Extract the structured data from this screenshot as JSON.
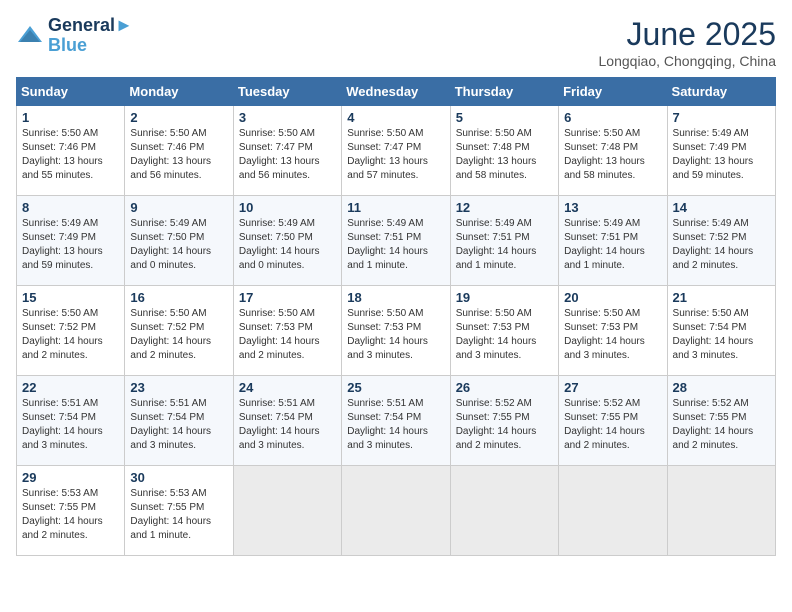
{
  "header": {
    "logo_line1": "General",
    "logo_line2": "Blue",
    "month_title": "June 2025",
    "location": "Longqiao, Chongqing, China"
  },
  "columns": [
    "Sunday",
    "Monday",
    "Tuesday",
    "Wednesday",
    "Thursday",
    "Friday",
    "Saturday"
  ],
  "weeks": [
    [
      {
        "day": "1",
        "info": "Sunrise: 5:50 AM\nSunset: 7:46 PM\nDaylight: 13 hours\nand 55 minutes."
      },
      {
        "day": "2",
        "info": "Sunrise: 5:50 AM\nSunset: 7:46 PM\nDaylight: 13 hours\nand 56 minutes."
      },
      {
        "day": "3",
        "info": "Sunrise: 5:50 AM\nSunset: 7:47 PM\nDaylight: 13 hours\nand 56 minutes."
      },
      {
        "day": "4",
        "info": "Sunrise: 5:50 AM\nSunset: 7:47 PM\nDaylight: 13 hours\nand 57 minutes."
      },
      {
        "day": "5",
        "info": "Sunrise: 5:50 AM\nSunset: 7:48 PM\nDaylight: 13 hours\nand 58 minutes."
      },
      {
        "day": "6",
        "info": "Sunrise: 5:50 AM\nSunset: 7:48 PM\nDaylight: 13 hours\nand 58 minutes."
      },
      {
        "day": "7",
        "info": "Sunrise: 5:49 AM\nSunset: 7:49 PM\nDaylight: 13 hours\nand 59 minutes."
      }
    ],
    [
      {
        "day": "8",
        "info": "Sunrise: 5:49 AM\nSunset: 7:49 PM\nDaylight: 13 hours\nand 59 minutes."
      },
      {
        "day": "9",
        "info": "Sunrise: 5:49 AM\nSunset: 7:50 PM\nDaylight: 14 hours\nand 0 minutes."
      },
      {
        "day": "10",
        "info": "Sunrise: 5:49 AM\nSunset: 7:50 PM\nDaylight: 14 hours\nand 0 minutes."
      },
      {
        "day": "11",
        "info": "Sunrise: 5:49 AM\nSunset: 7:51 PM\nDaylight: 14 hours\nand 1 minute."
      },
      {
        "day": "12",
        "info": "Sunrise: 5:49 AM\nSunset: 7:51 PM\nDaylight: 14 hours\nand 1 minute."
      },
      {
        "day": "13",
        "info": "Sunrise: 5:49 AM\nSunset: 7:51 PM\nDaylight: 14 hours\nand 1 minute."
      },
      {
        "day": "14",
        "info": "Sunrise: 5:49 AM\nSunset: 7:52 PM\nDaylight: 14 hours\nand 2 minutes."
      }
    ],
    [
      {
        "day": "15",
        "info": "Sunrise: 5:50 AM\nSunset: 7:52 PM\nDaylight: 14 hours\nand 2 minutes."
      },
      {
        "day": "16",
        "info": "Sunrise: 5:50 AM\nSunset: 7:52 PM\nDaylight: 14 hours\nand 2 minutes."
      },
      {
        "day": "17",
        "info": "Sunrise: 5:50 AM\nSunset: 7:53 PM\nDaylight: 14 hours\nand 2 minutes."
      },
      {
        "day": "18",
        "info": "Sunrise: 5:50 AM\nSunset: 7:53 PM\nDaylight: 14 hours\nand 3 minutes."
      },
      {
        "day": "19",
        "info": "Sunrise: 5:50 AM\nSunset: 7:53 PM\nDaylight: 14 hours\nand 3 minutes."
      },
      {
        "day": "20",
        "info": "Sunrise: 5:50 AM\nSunset: 7:53 PM\nDaylight: 14 hours\nand 3 minutes."
      },
      {
        "day": "21",
        "info": "Sunrise: 5:50 AM\nSunset: 7:54 PM\nDaylight: 14 hours\nand 3 minutes."
      }
    ],
    [
      {
        "day": "22",
        "info": "Sunrise: 5:51 AM\nSunset: 7:54 PM\nDaylight: 14 hours\nand 3 minutes."
      },
      {
        "day": "23",
        "info": "Sunrise: 5:51 AM\nSunset: 7:54 PM\nDaylight: 14 hours\nand 3 minutes."
      },
      {
        "day": "24",
        "info": "Sunrise: 5:51 AM\nSunset: 7:54 PM\nDaylight: 14 hours\nand 3 minutes."
      },
      {
        "day": "25",
        "info": "Sunrise: 5:51 AM\nSunset: 7:54 PM\nDaylight: 14 hours\nand 3 minutes."
      },
      {
        "day": "26",
        "info": "Sunrise: 5:52 AM\nSunset: 7:55 PM\nDaylight: 14 hours\nand 2 minutes."
      },
      {
        "day": "27",
        "info": "Sunrise: 5:52 AM\nSunset: 7:55 PM\nDaylight: 14 hours\nand 2 minutes."
      },
      {
        "day": "28",
        "info": "Sunrise: 5:52 AM\nSunset: 7:55 PM\nDaylight: 14 hours\nand 2 minutes."
      }
    ],
    [
      {
        "day": "29",
        "info": "Sunrise: 5:53 AM\nSunset: 7:55 PM\nDaylight: 14 hours\nand 2 minutes."
      },
      {
        "day": "30",
        "info": "Sunrise: 5:53 AM\nSunset: 7:55 PM\nDaylight: 14 hours\nand 1 minute."
      },
      {
        "day": "",
        "info": ""
      },
      {
        "day": "",
        "info": ""
      },
      {
        "day": "",
        "info": ""
      },
      {
        "day": "",
        "info": ""
      },
      {
        "day": "",
        "info": ""
      }
    ]
  ]
}
